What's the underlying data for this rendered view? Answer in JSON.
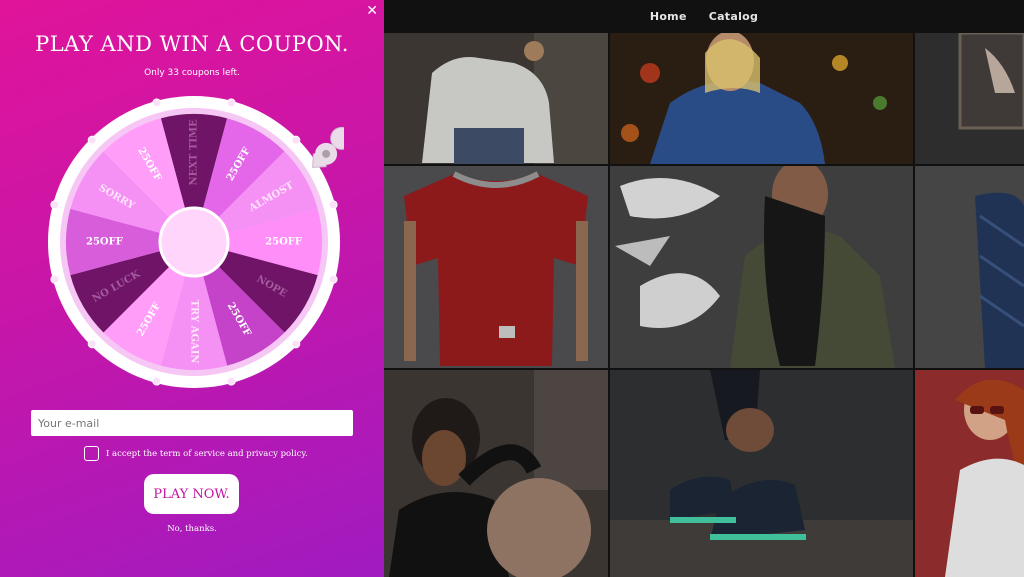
{
  "nav": {
    "items": [
      "Home",
      "Catalog"
    ]
  },
  "popup": {
    "close_icon": "close-icon",
    "title": "PLAY AND WIN A COUPON.",
    "subtitle": "Only 33 coupons left.",
    "email_placeholder": "Your e-mail",
    "terms_label": "I accept the term of service and privacy policy.",
    "play_label": "PLAY NOW.",
    "no_thanks_label": "No, thanks."
  },
  "wheel": {
    "segments": [
      {
        "label": "NEXT TIME",
        "color": "#6f1466",
        "text": "#a55c9f"
      },
      {
        "label": "25OFF",
        "color": "#e467ea",
        "text": "#ffffff"
      },
      {
        "label": "ALMOST",
        "color": "#f591f5",
        "text": "#ffe4fb"
      },
      {
        "label": "25OFF",
        "color": "#ff8ef9",
        "text": "#ffffff"
      },
      {
        "label": "NOPE",
        "color": "#6f1466",
        "text": "#a55c9f"
      },
      {
        "label": "25OFF",
        "color": "#c443c9",
        "text": "#ffffff"
      },
      {
        "label": "TRY AGAIN",
        "color": "#f591f5",
        "text": "#ffe4fb"
      },
      {
        "label": "25OFF",
        "color": "#ff9df8",
        "text": "#ffffff"
      },
      {
        "label": "NO LUCK",
        "color": "#6f1466",
        "text": "#a55c9f"
      },
      {
        "label": "25OFF",
        "color": "#d75ddb",
        "text": "#ffffff"
      },
      {
        "label": "SORRY",
        "color": "#f591f5",
        "text": "#ffe4fb"
      },
      {
        "label": "25OFF",
        "color": "#ff9df8",
        "text": "#ffffff"
      }
    ],
    "pointer_icon": "map-pin-icon"
  },
  "colors": {
    "accent": "#e0149a",
    "accent_2": "#a01bc0",
    "wheel_rim": "#ffffff"
  }
}
